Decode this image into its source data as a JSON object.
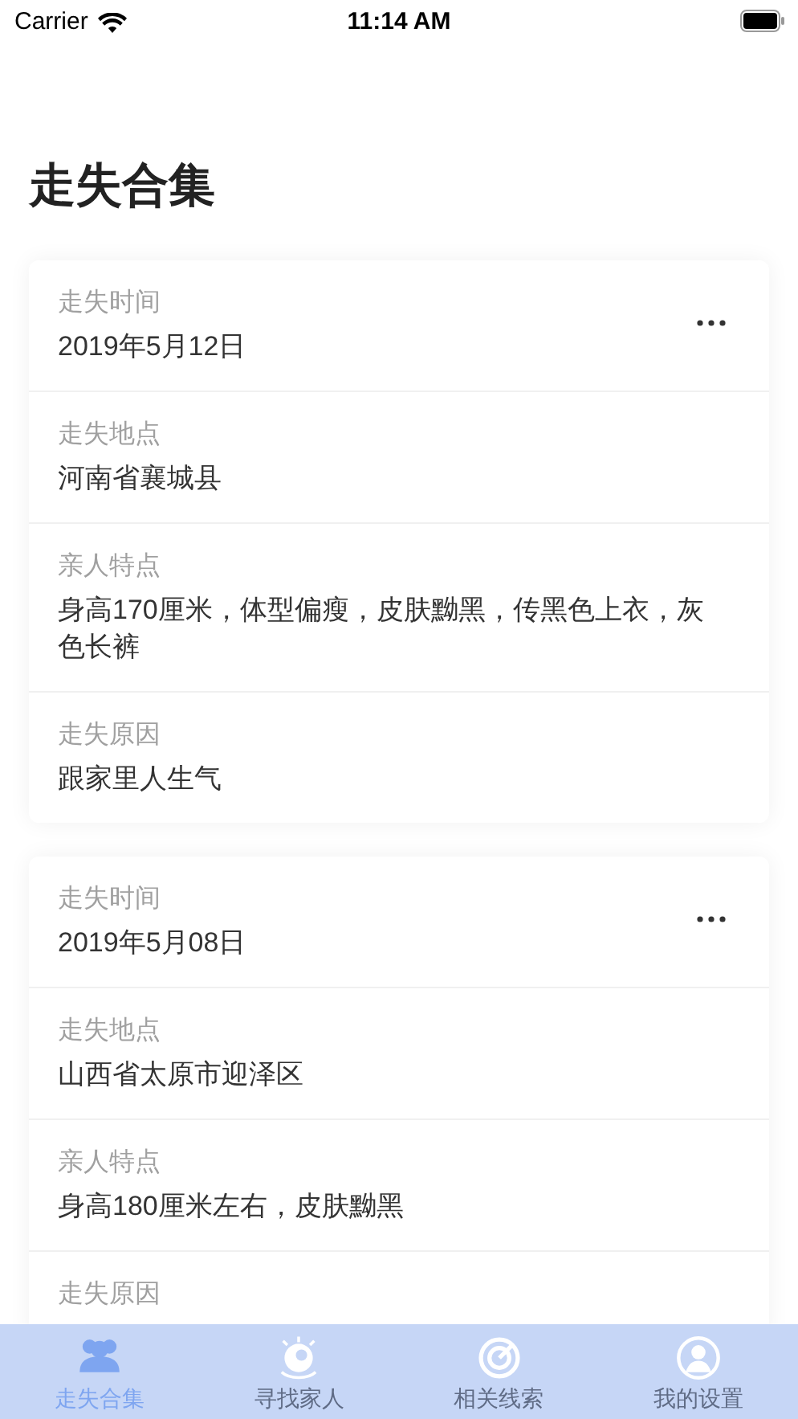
{
  "status_bar": {
    "carrier": "Carrier",
    "time": "11:14 AM"
  },
  "title": "走失合集",
  "cards": [
    {
      "fields": [
        {
          "label": "走失时间",
          "value": "2019年5月12日"
        },
        {
          "label": "走失地点",
          "value": "河南省襄城县"
        },
        {
          "label": "亲人特点",
          "value": "身高170厘米，体型偏瘦，皮肤黝黑，传黑色上衣，灰色长裤"
        },
        {
          "label": "走失原因",
          "value": "跟家里人生气"
        }
      ]
    },
    {
      "fields": [
        {
          "label": "走失时间",
          "value": "2019年5月08日"
        },
        {
          "label": "走失地点",
          "value": "山西省太原市迎泽区"
        },
        {
          "label": "亲人特点",
          "value": "身高180厘米左右，皮肤黝黑"
        },
        {
          "label": "走失原因"
        }
      ]
    }
  ],
  "tab_bar": [
    {
      "kind": "people",
      "label": "走失合集",
      "selected": true
    },
    {
      "kind": "eye",
      "label": "寻找家人",
      "selected": false
    },
    {
      "kind": "target",
      "label": "相关线索",
      "selected": false
    },
    {
      "kind": "user",
      "label": "我的设置",
      "selected": false
    }
  ]
}
